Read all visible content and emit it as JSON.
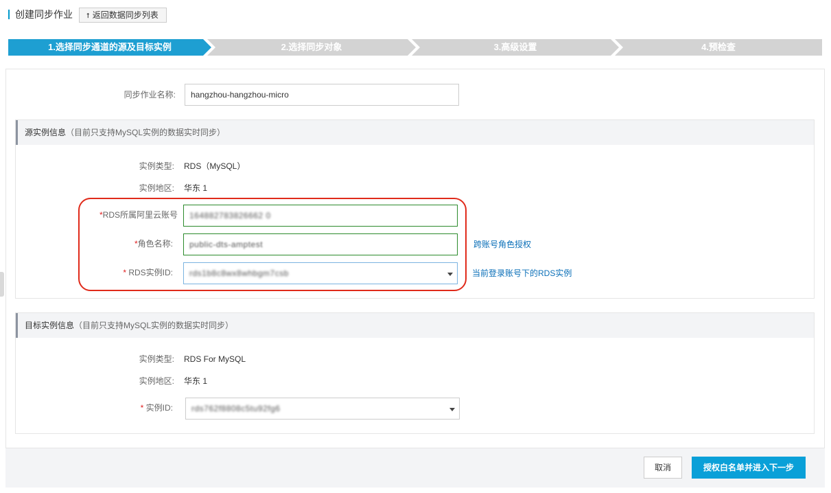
{
  "header": {
    "title": "创建同步作业",
    "back_label": "返回数据同步列表"
  },
  "steps": [
    {
      "label": "1.选择同步通道的源及目标实例",
      "active": true
    },
    {
      "label": "2.选择同步对象",
      "active": false
    },
    {
      "label": "3.高级设置",
      "active": false
    },
    {
      "label": "4.预检查",
      "active": false
    }
  ],
  "job": {
    "name_label": "同步作业名称:",
    "name_value": "hangzhou-hangzhou-micro"
  },
  "source": {
    "heading": "源实例信息",
    "heading_note": "（目前只支持MySQL实例的数据实时同步）",
    "type_label": "实例类型:",
    "type_value": "RDS（MySQL）",
    "region_label": "实例地区:",
    "region_value": "华东 1",
    "account_label": "RDS所属阿里云账号",
    "account_value": "164882783826662 0",
    "role_label": "角色名称:",
    "role_value": "public-dts-amptest",
    "role_link": "跨账号角色授权",
    "instance_label": "RDS实例ID:",
    "instance_value": "rds1b8c8wx8whbgm7csb",
    "instance_link": "当前登录账号下的RDS实例"
  },
  "target": {
    "heading": "目标实例信息",
    "heading_note": "（目前只支持MySQL实例的数据实时同步）",
    "type_label": "实例类型:",
    "type_value": "RDS For MySQL",
    "region_label": "实例地区:",
    "region_value": "华东 1",
    "instance_label": "实例ID:",
    "instance_value": "rds762f8808c5tu92fg6"
  },
  "footer": {
    "cancel_label": "取消",
    "next_label": "授权白名单并进入下一步"
  },
  "colors": {
    "step_active": "#1e9fd2",
    "step_inactive": "#d3d3d3",
    "primary": "#0aa0d8",
    "highlight": "#e02a1a",
    "input_green": "#2b8a2b"
  }
}
